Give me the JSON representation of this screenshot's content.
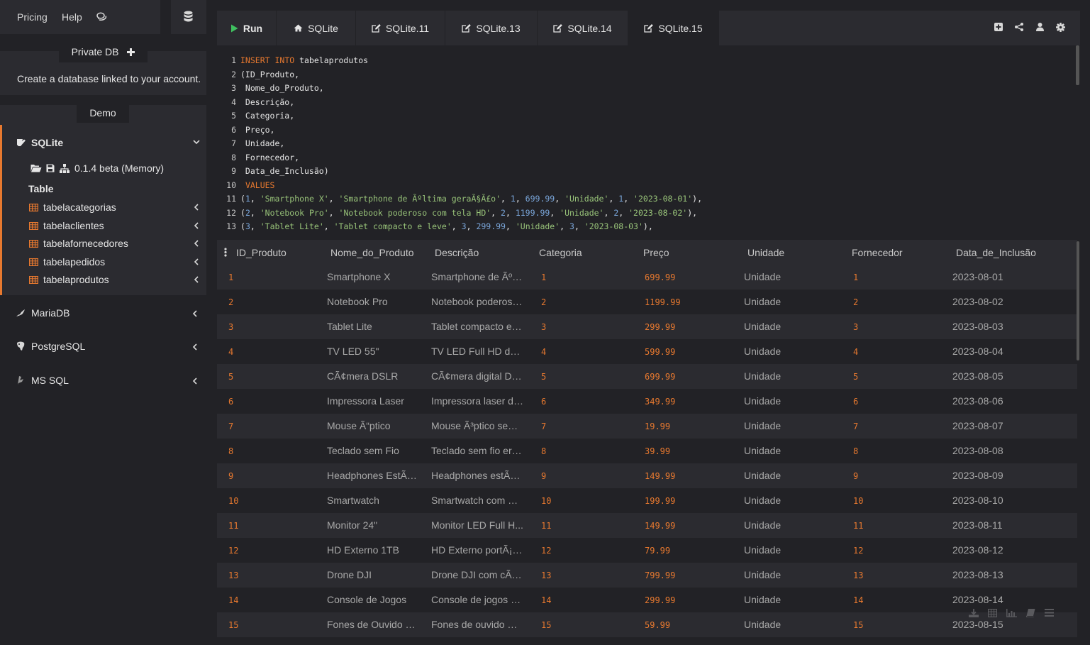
{
  "topbar": {
    "pricing": "Pricing",
    "help": "Help"
  },
  "private_db": {
    "label": "Private DB",
    "description": "Create a database linked to your account."
  },
  "demo": {
    "label": "Demo"
  },
  "sqlite": {
    "label": "SQLite",
    "version": "0.1.4 beta (Memory)",
    "table_heading": "Table",
    "tables": [
      "tabelacategorias",
      "tabelaclientes",
      "tabelafornecedores",
      "tabelapedidos",
      "tabelaprodutos"
    ]
  },
  "databases": [
    "MariaDB",
    "PostgreSQL",
    "MS SQL"
  ],
  "tabs": {
    "run": "Run",
    "t0": "SQLite",
    "t1": "SQLite.11",
    "t2": "SQLite.13",
    "t3": "SQLite.14",
    "t4": "SQLite.15"
  },
  "editor": {
    "lines": [
      "INSERT INTO tabelaprodutos",
      "(ID_Produto,",
      " Nome_do_Produto,",
      " Descrição,",
      " Categoria,",
      " Preço,",
      " Unidade,",
      " Fornecedor,",
      " Data_de_Inclusão)",
      " VALUES",
      "(1, 'Smartphone X', 'Smartphone de Ãºltima geraÃ§Ã£o', 1, 699.99, 'Unidade', 1, '2023-08-01'),",
      "(2, 'Notebook Pro', 'Notebook poderoso com tela HD', 2, 1199.99, 'Unidade', 2, '2023-08-02'),",
      "(3, 'Tablet Lite', 'Tablet compacto e leve', 3, 299.99, 'Unidade', 3, '2023-08-03'),"
    ]
  },
  "grid": {
    "columns": [
      "ID_Produto",
      "Nome_do_Produto",
      "Descrição",
      "Categoria",
      "Preço",
      "Unidade",
      "Fornecedor",
      "Data_de_Inclusão"
    ],
    "rows": [
      [
        "1",
        "Smartphone X",
        "Smartphone de Ãºlti...",
        "1",
        "699.99",
        "Unidade",
        "1",
        "2023-08-01"
      ],
      [
        "2",
        "Notebook Pro",
        "Notebook poderoso ...",
        "2",
        "1199.99",
        "Unidade",
        "2",
        "2023-08-02"
      ],
      [
        "3",
        "Tablet Lite",
        "Tablet compacto e l...",
        "3",
        "299.99",
        "Unidade",
        "3",
        "2023-08-03"
      ],
      [
        "4",
        "TV LED 55\"",
        "TV LED Full HD de ...",
        "4",
        "599.99",
        "Unidade",
        "4",
        "2023-08-04"
      ],
      [
        "5",
        "CÃ¢mera DSLR",
        "CÃ¢mera digital DS...",
        "5",
        "699.99",
        "Unidade",
        "5",
        "2023-08-05"
      ],
      [
        "6",
        "Impressora Laser",
        "Impressora laser de...",
        "6",
        "349.99",
        "Unidade",
        "6",
        "2023-08-06"
      ],
      [
        "7",
        "Mouse Ã“ptico",
        "Mouse Ã³ptico sem fio",
        "7",
        "19.99",
        "Unidade",
        "7",
        "2023-08-07"
      ],
      [
        "8",
        "Teclado sem Fio",
        "Teclado sem fio erg...",
        "8",
        "39.99",
        "Unidade",
        "8",
        "2023-08-08"
      ],
      [
        "9",
        "Headphones EstÃ©...",
        "Headphones estÃ©r...",
        "9",
        "149.99",
        "Unidade",
        "9",
        "2023-08-09"
      ],
      [
        "10",
        "Smartwatch",
        "Smartwatch com m...",
        "10",
        "199.99",
        "Unidade",
        "10",
        "2023-08-10"
      ],
      [
        "11",
        "Monitor 24\"",
        "Monitor LED Full H...",
        "11",
        "149.99",
        "Unidade",
        "11",
        "2023-08-11"
      ],
      [
        "12",
        "HD Externo 1TB",
        "HD Externo portÃ¡til...",
        "12",
        "79.99",
        "Unidade",
        "12",
        "2023-08-12"
      ],
      [
        "13",
        "Drone DJI",
        "Drone DJI com cÃ¢...",
        "13",
        "799.99",
        "Unidade",
        "13",
        "2023-08-13"
      ],
      [
        "14",
        "Console de Jogos",
        "Console de jogos d...",
        "14",
        "299.99",
        "Unidade",
        "14",
        "2023-08-14"
      ],
      [
        "15",
        "Fones de Ouvido Bl...",
        "Fones de ouvido Bl...",
        "15",
        "59.99",
        "Unidade",
        "15",
        "2023-08-15"
      ]
    ]
  },
  "colors": {
    "accent": "#e8792f",
    "string": "#98c379",
    "number": "#7aa6da",
    "panel": "#2b2b30",
    "background": "#222226"
  }
}
